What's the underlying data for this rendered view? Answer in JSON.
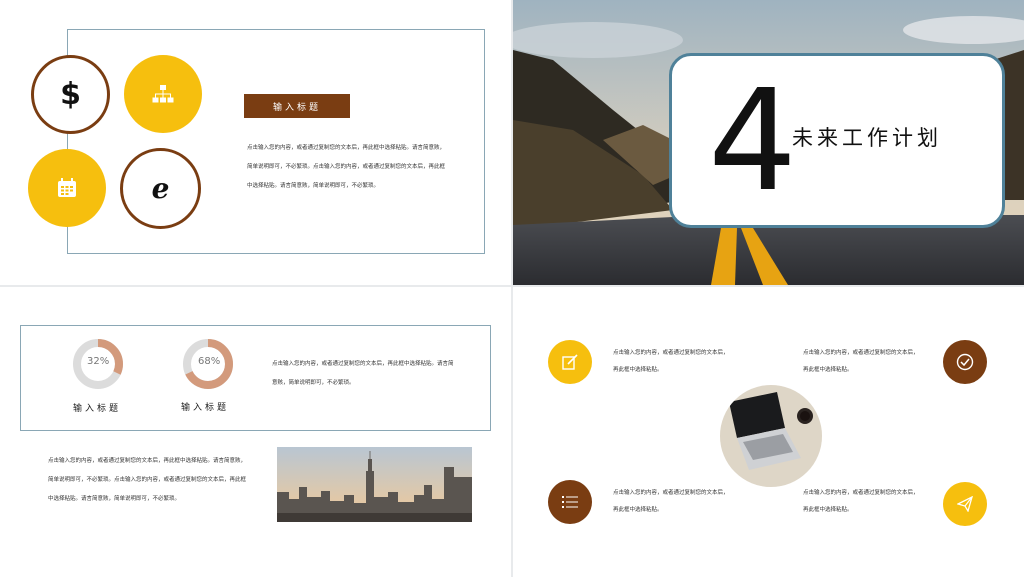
{
  "slide1": {
    "title_label": "输入标题",
    "body_lines": [
      "点击输入您的内容，或者通过复制您的文本后，再此框中选择粘贴。请言简意赅，",
      "简单说明即可，不必繁琐。点击输入您的内容，或者通过复制您的文本后，再此框",
      "中选择粘贴。请言简意赅，简单说明即可，不必繁琐。"
    ],
    "icons": [
      "dollar-icon",
      "org-chart-icon",
      "calendar-icon",
      "ie-icon"
    ]
  },
  "slide2": {
    "number": "4",
    "chapter_title": "未来工作计划"
  },
  "slide3": {
    "donuts": [
      {
        "percent_label": "32%",
        "value": 0.32,
        "label": "输入标题"
      },
      {
        "percent_label": "68%",
        "value": 0.68,
        "label": "输入标题"
      }
    ],
    "right_text": [
      "点击输入您的内容，或者通过复制您的文本后，再此框中选择粘贴。请言简",
      "意赅，简单说明即可，不必繁琐。"
    ],
    "bottom_text": [
      "点击输入您的内容，或者通过复制您的文本后，再此框中选择粘贴。请言简意赅，",
      "简单说明即可，不必繁琐。点击输入您的内容，或者通过复制您的文本后，再此框",
      "中选择粘贴。请言简意赅，简单说明即可，不必繁琐。"
    ]
  },
  "slide4": {
    "items": [
      {
        "line1": "点击输入您的内容，或者通过复制您的文本后，",
        "line2": "再此框中选择粘贴。",
        "icon": "edit-icon"
      },
      {
        "line1": "点击输入您的内容，或者通过复制您的文本后，",
        "line2": "再此框中选择粘贴。",
        "icon": "check-icon"
      },
      {
        "line1": "点击输入您的内容，或者通过复制您的文本后，",
        "line2": "再此框中选择粘贴。",
        "icon": "list-icon"
      },
      {
        "line1": "点击输入您的内容，或者通过复制您的文本后，",
        "line2": "再此框中选择粘贴。",
        "icon": "send-icon"
      }
    ]
  },
  "colors": {
    "yellow": "#f6bf0e",
    "brown": "#7a3d12",
    "frame": "#8aa7b5",
    "card_border": "#4f8199",
    "donut_fill": "#d39a7c",
    "donut_track": "#dcdcdc"
  }
}
